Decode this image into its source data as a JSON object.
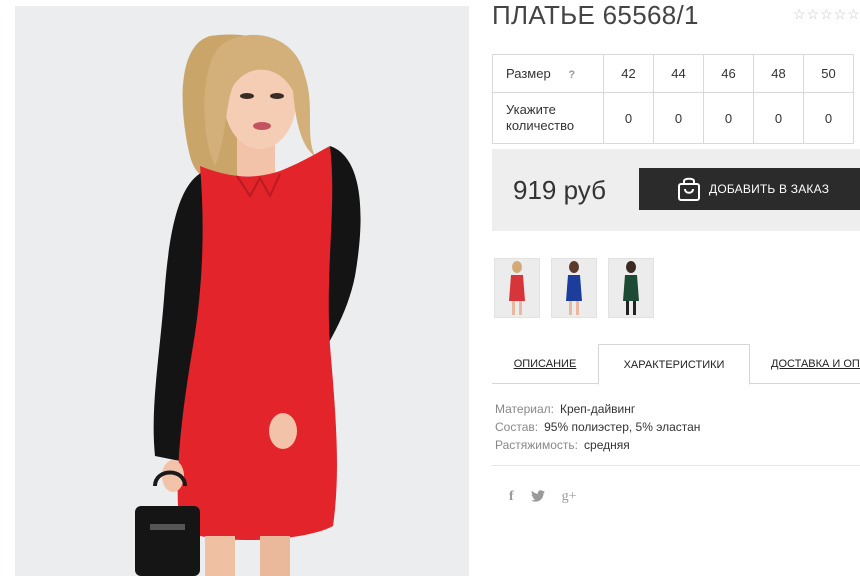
{
  "product": {
    "title": "ПЛАТЬЕ 65568/1",
    "rating_stars": 5
  },
  "size_table": {
    "size_label": "Размер",
    "help_icon": "?",
    "sizes": [
      "42",
      "44",
      "46",
      "48",
      "50"
    ],
    "qty_label": "Укажите количество",
    "quantities": [
      "0",
      "0",
      "0",
      "0",
      "0"
    ]
  },
  "purchase": {
    "price": "919 руб",
    "add_button_label": "ДОБАВИТЬ В ЗАКАЗ",
    "add_button_icon": "shopping-bag-icon"
  },
  "thumbnails": [
    {
      "name": "red-dress",
      "dress_color": "#d6363a"
    },
    {
      "name": "blue-dress",
      "dress_color": "#1d3d9c"
    },
    {
      "name": "green-dress",
      "dress_color": "#1d4a35"
    }
  ],
  "tabs": [
    {
      "label": "ОПИСАНИЕ",
      "active": false
    },
    {
      "label": "ХАРАКТЕРИСТИКИ",
      "active": true
    },
    {
      "label": "ДОСТАВКА И ОПЛ",
      "active": false
    }
  ],
  "characteristics": [
    {
      "key": "Материал:",
      "value": "Креп-дайвинг"
    },
    {
      "key": "Состав:",
      "value": "95% полиэстер, 5% эластан"
    },
    {
      "key": "Растяжимость:",
      "value": "средняя"
    }
  ],
  "social": {
    "facebook": "f",
    "twitter": "twitter-bird-icon",
    "googleplus": "g+"
  },
  "colors": {
    "dark_button": "#2b2b2b",
    "price_box": "#eeeeee",
    "dress_red": "#e3242b"
  }
}
